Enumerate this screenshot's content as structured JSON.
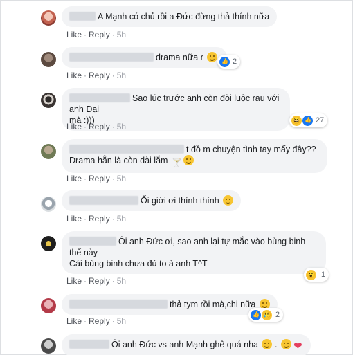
{
  "actions": {
    "like_label": "Like",
    "reply_label": "Reply",
    "separator": "·"
  },
  "comments": [
    {
      "text": "A Mạnh có chủ rồi a Đức đừng thả thính nữa",
      "time": "5h"
    },
    {
      "text": "drama nữa r",
      "time": "5h",
      "reaction_count": "2"
    },
    {
      "line1": "Sao lúc trước anh còn đòi luộc rau với anh Đại",
      "line2": "mà :)))",
      "time": "5h",
      "reaction_count": "27"
    },
    {
      "line1": "t đồ m chuyện tình tay mấy đây??",
      "line2": "Drama hẳn là còn dài lắm",
      "time": "5h"
    },
    {
      "text": "Ối giời ơi thính thính",
      "time": "5h"
    },
    {
      "line1": "Ôi anh Đức ơi, sao anh lại tự mắc vào bùng binh",
      "line2": "thế này",
      "line3": "Cái bùng binh chưa đủ to à anh T^T",
      "time": "5h",
      "reaction_count": "1"
    },
    {
      "text": "thả tym rồi mà,chi nữa",
      "time": "5h",
      "reaction_count": "2"
    },
    {
      "text": "Ôi anh Đức vs anh Mạnh ghê quá nha",
      "suffix": " ."
    }
  ],
  "colors": {
    "bubble": "#f2f3f5",
    "action_link": "#4b4f56",
    "like_blue": "#1877f2",
    "emoji_yellow": "#f7c531"
  }
}
